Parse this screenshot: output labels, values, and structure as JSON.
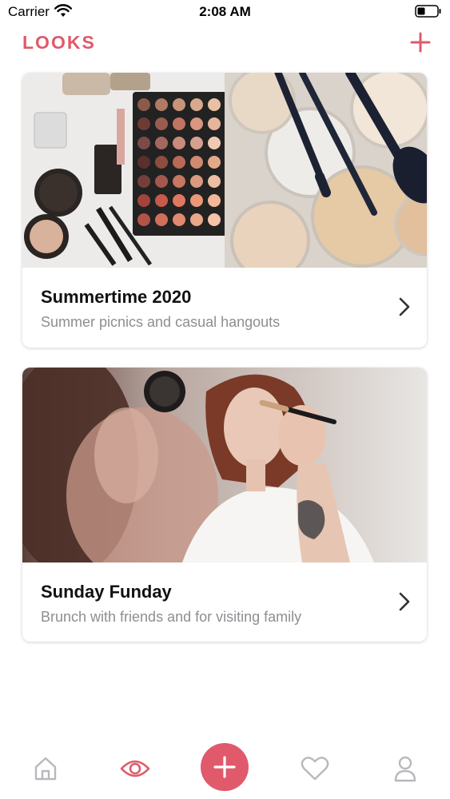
{
  "status_bar": {
    "carrier": "Carrier",
    "time": "2:08 AM"
  },
  "header": {
    "title": "LOOKS",
    "add_icon": "plus-icon"
  },
  "looks": [
    {
      "title": "Summertime 2020",
      "subtitle": "Summer picnics and casual hangouts",
      "image": "makeup-palette-and-brushes-photo"
    },
    {
      "title": "Sunday Funday",
      "subtitle": "Brunch with friends and for visiting family",
      "image": "woman-applying-makeup-photo"
    }
  ],
  "tab_bar": {
    "items": [
      {
        "icon": "home-icon",
        "active": false
      },
      {
        "icon": "eye-icon",
        "active": true
      },
      {
        "icon": "plus-icon",
        "active": false
      },
      {
        "icon": "heart-icon",
        "active": false
      },
      {
        "icon": "person-icon",
        "active": false
      }
    ]
  },
  "colors": {
    "accent": "#e05a6b",
    "inactive_icon": "#b8b8bd",
    "subtitle": "#8e8e93"
  }
}
